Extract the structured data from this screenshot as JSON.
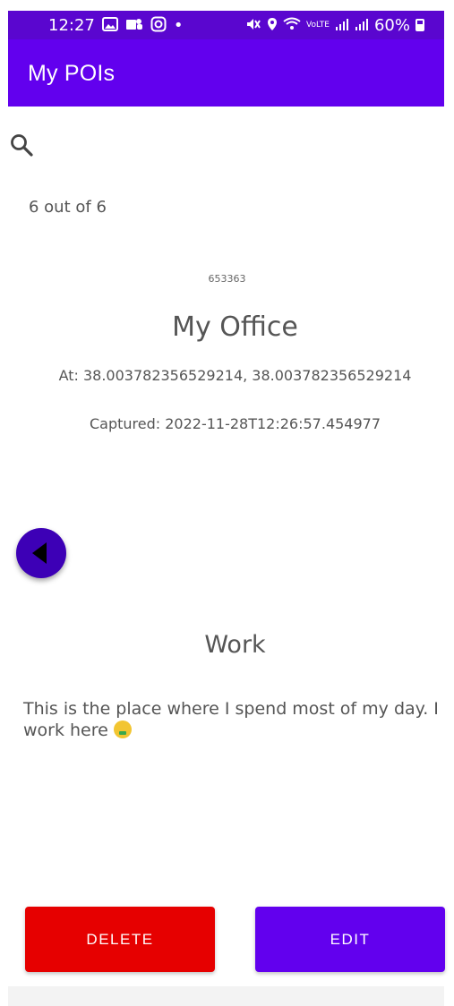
{
  "status_bar": {
    "time": "12:27",
    "dot": "•",
    "battery": "60%",
    "left_icons": [
      "gallery-icon",
      "teams-icon",
      "instagram-icon"
    ],
    "right_icons": [
      "mute-icon",
      "location-icon",
      "wifi-icon",
      "volte-icon",
      "signal-icon",
      "signal-icon",
      "battery-icon"
    ],
    "background": "#5a06cf"
  },
  "app_bar": {
    "title": "My POIs",
    "background": "#6200ee"
  },
  "search": {
    "icon": "search-icon"
  },
  "counter": "6 out of 6",
  "poi": {
    "id": "653363",
    "name": "My Office",
    "coordinates": "At: 38.003782356529214, 38.003782356529214",
    "captured": "Captured: 2022-11-28T12:26:57.454977",
    "category": "Work",
    "description": "This is the place where I spend most of my day. I work here"
  },
  "navigation": {
    "prev_icon": "arrow-left-icon",
    "prev_color": "#3d00b6"
  },
  "actions": {
    "delete_label": "DELETE",
    "edit_label": "EDIT",
    "delete_color": "#e60000",
    "edit_color": "#6200ee"
  }
}
